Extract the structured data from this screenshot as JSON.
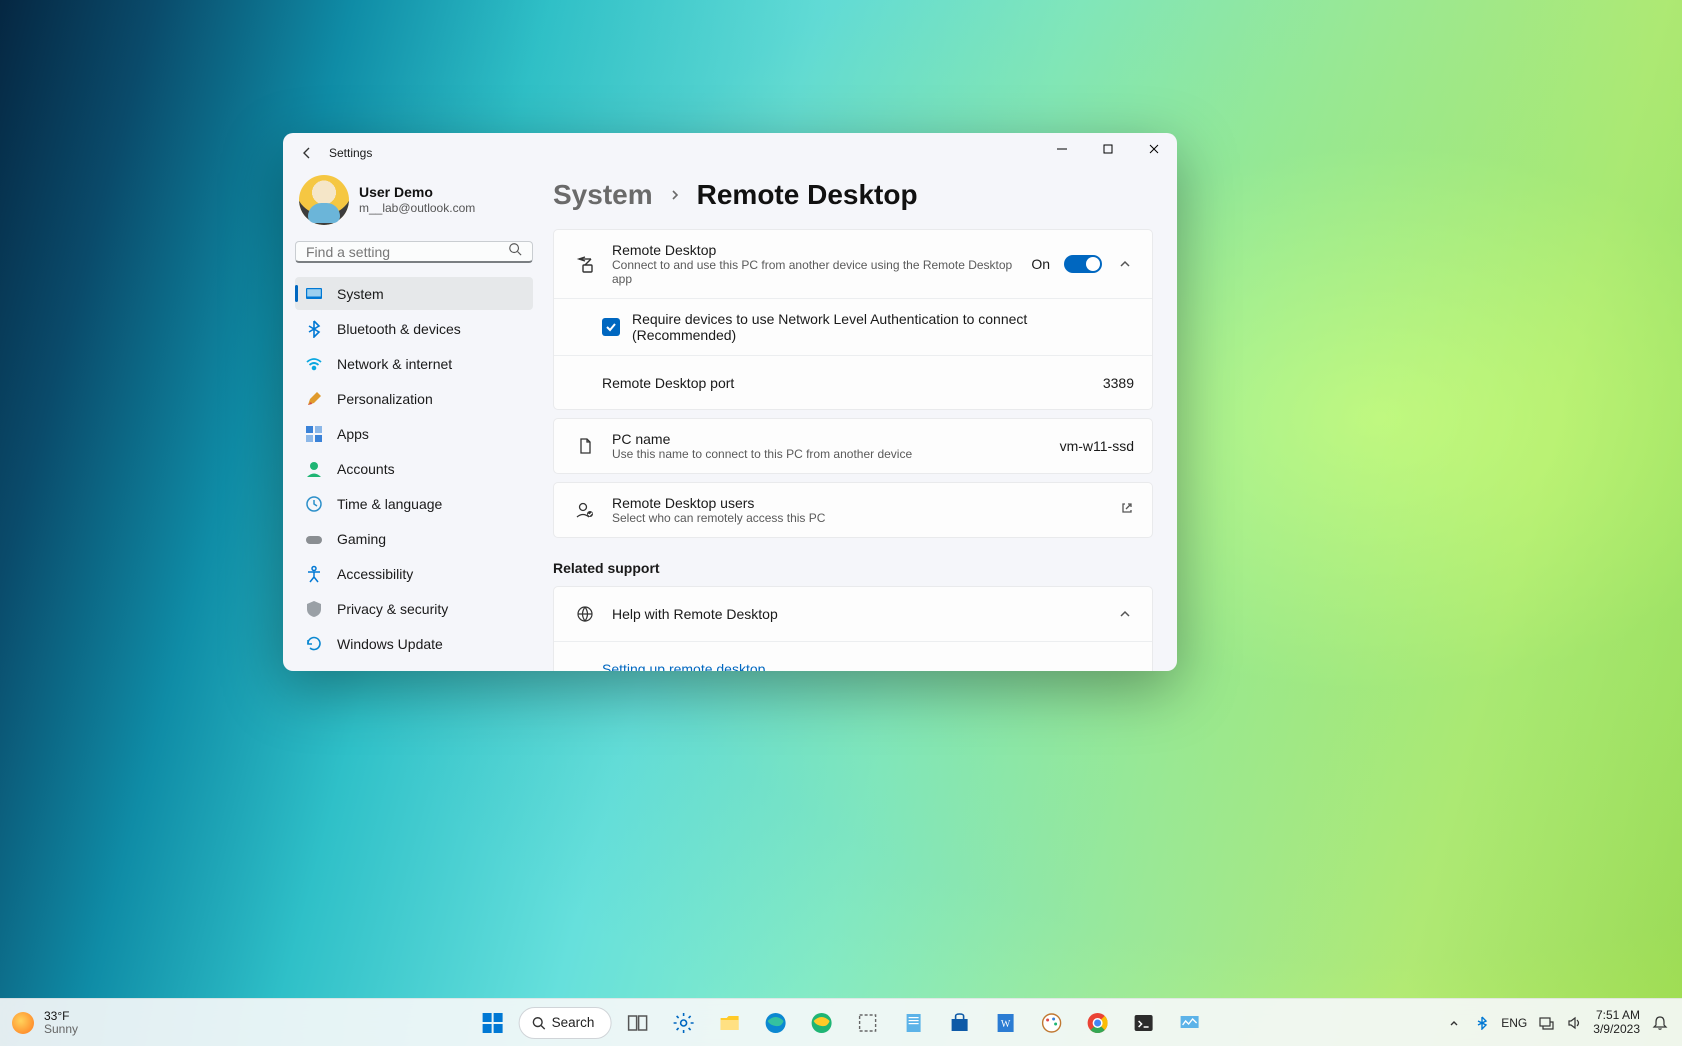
{
  "window": {
    "title": "Settings"
  },
  "user": {
    "name": "User Demo",
    "email": "m__lab@outlook.com"
  },
  "search": {
    "placeholder": "Find a setting"
  },
  "sidebar": {
    "items": [
      {
        "label": "System",
        "active": true
      },
      {
        "label": "Bluetooth & devices"
      },
      {
        "label": "Network & internet"
      },
      {
        "label": "Personalization"
      },
      {
        "label": "Apps"
      },
      {
        "label": "Accounts"
      },
      {
        "label": "Time & language"
      },
      {
        "label": "Gaming"
      },
      {
        "label": "Accessibility"
      },
      {
        "label": "Privacy & security"
      },
      {
        "label": "Windows Update"
      }
    ]
  },
  "breadcrumb": {
    "parent": "System",
    "current": "Remote Desktop"
  },
  "remote_desktop": {
    "title": "Remote Desktop",
    "subtitle": "Connect to and use this PC from another device using the Remote Desktop app",
    "state_label": "On",
    "nla_label": "Require devices to use Network Level Authentication to connect (Recommended)",
    "nla_checked": true,
    "port_label": "Remote Desktop port",
    "port_value": "3389"
  },
  "pc_name": {
    "title": "PC name",
    "subtitle": "Use this name to connect to this PC from another device",
    "value": "vm-w11-ssd"
  },
  "rdp_users": {
    "title": "Remote Desktop users",
    "subtitle": "Select who can remotely access this PC"
  },
  "related": {
    "heading": "Related support",
    "help_title": "Help with Remote Desktop",
    "help_link": "Setting up remote desktop"
  },
  "taskbar": {
    "weather_temp": "33°F",
    "weather_cond": "Sunny",
    "search_label": "Search",
    "lang": "ENG",
    "time": "7:51 AM",
    "date": "3/9/2023"
  }
}
